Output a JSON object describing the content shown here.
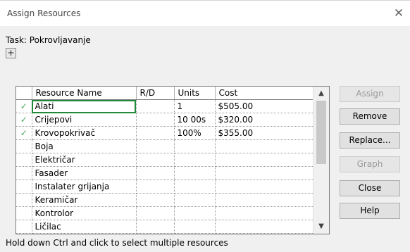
{
  "dialog": {
    "title": "Assign Resources",
    "close_glyph": "✕",
    "task_label": "Task: Pokrovljavanje",
    "expand_glyph": "+",
    "footer_hint": "Hold down Ctrl and click to select multiple resources"
  },
  "grid": {
    "columns": [
      "",
      "Resource Name",
      "R/D",
      "Units",
      "Cost"
    ],
    "rows": [
      {
        "check": "✓",
        "name": "Alati",
        "rd": "",
        "units": "1",
        "cost": "$505.00"
      },
      {
        "check": "✓",
        "name": "Crijepovi",
        "rd": "",
        "units": "10 00s",
        "cost": "$320.00"
      },
      {
        "check": "✓",
        "name": "Krovopokrivač",
        "rd": "",
        "units": "100%",
        "cost": "$355.00"
      },
      {
        "check": "",
        "name": "Boja",
        "rd": "",
        "units": "",
        "cost": ""
      },
      {
        "check": "",
        "name": "Električar",
        "rd": "",
        "units": "",
        "cost": ""
      },
      {
        "check": "",
        "name": "Fasader",
        "rd": "",
        "units": "",
        "cost": ""
      },
      {
        "check": "",
        "name": "Instalater grijanja",
        "rd": "",
        "units": "",
        "cost": ""
      },
      {
        "check": "",
        "name": "Keramičar",
        "rd": "",
        "units": "",
        "cost": ""
      },
      {
        "check": "",
        "name": "Kontrolor",
        "rd": "",
        "units": "",
        "cost": ""
      },
      {
        "check": "",
        "name": "Ličilac",
        "rd": "",
        "units": "",
        "cost": ""
      }
    ],
    "scroll_up_glyph": "▲",
    "scroll_down_glyph": "▼"
  },
  "buttons": {
    "assign": "Assign",
    "remove": "Remove",
    "replace": "Replace...",
    "graph": "Graph",
    "close": "Close",
    "help": "Help"
  },
  "colors": {
    "check": "#4aa45c",
    "selection_outline": "#1f8a3a"
  }
}
